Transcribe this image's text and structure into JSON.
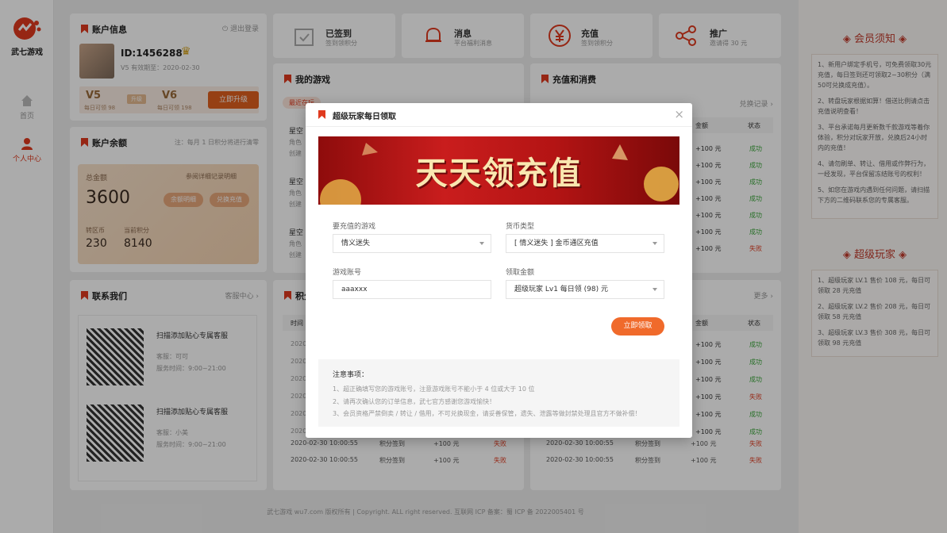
{
  "brand": {
    "name": "武七游戏"
  },
  "nav": {
    "home": "首页",
    "personal": "个人中心"
  },
  "account": {
    "title": "账户信息",
    "logout": "退出登录",
    "id": "ID:1456288",
    "vip_expire": "V5 有效期至：2020-02-30",
    "level_current": "V5",
    "level_current_desc": "每日可领 98",
    "upgrade_tag": "升级",
    "level_next": "V6",
    "level_next_desc": "每日可领 198",
    "upgrade_button": "立即升级"
  },
  "balance": {
    "title": "账户余额",
    "note": "注：每月 1 日积分将进行清零",
    "total_label": "总金额",
    "total": "3600",
    "exchange_record": "兑换记录",
    "details_link": "参阅详细记录明细",
    "balance_detail": "余额明细",
    "exchange_recharge": "兑换充值",
    "coin_label": "转区币",
    "coin_value": "230",
    "points_label": "当前积分",
    "points_value": "8140"
  },
  "quick": [
    {
      "title": "已签到",
      "desc": "签到领积分"
    },
    {
      "title": "消息",
      "desc": "平台福利消息"
    },
    {
      "title": "充值",
      "desc": "签到领积分"
    },
    {
      "title": "推广",
      "desc": "邀请得 30 元"
    }
  ],
  "my_games": {
    "title": "我的游戏",
    "tab": "最近在玩",
    "row_title": "星空",
    "row_desc1": "角色",
    "row_desc2": "创建"
  },
  "recharge": {
    "title": "充值和消费",
    "link": "兑换记录",
    "col_amount": "金额",
    "col_status": "状态"
  },
  "contact": {
    "title": "联系我们",
    "link": "客服中心",
    "items": [
      {
        "title": "扫描添加贴心专属客服",
        "name": "客服：可可",
        "hours": "服务时间：9:00~21:00"
      },
      {
        "title": "扫描添加贴心专属客服",
        "name": "客服：小美",
        "hours": "服务时间：9:00~21:00"
      }
    ]
  },
  "points": {
    "title": "积分",
    "col_time": "时间",
    "more": "更多"
  },
  "table_rows": [
    {
      "time": "2020-02-30 10:00:55",
      "type": "积分签到",
      "amount": "+100 元",
      "status": "失败"
    },
    {
      "time": "2020-02-30 10:00:55",
      "type": "积分签到",
      "amount": "+100 元",
      "status": "失败"
    }
  ],
  "status_list_top": [
    "成功",
    "成功",
    "成功",
    "成功",
    "成功",
    "成功",
    "失败"
  ],
  "status_list_bottom": [
    "成功",
    "成功",
    "成功",
    "失败",
    "成功",
    "成功"
  ],
  "amount_each": "+100 元",
  "year_stub": "2020",
  "right_panel": {
    "member_title": "会员须知",
    "member_rules": [
      "1、新用户绑定手机号，可免费领取30元充值，每日签到还可领取2~30积分（满50可兑换成充值）。",
      "2、转盘玩家根据如算！借送比例请点击充值说明查看！",
      "3、平台承诺每月更新数千款游戏等着你体验，积分对玩家开放，兑换后24小时内的充值！",
      "4、请勿刷单、转让、借用或作弊行为，一经发现，平台保留冻结账号的权利！",
      "5、如您在游戏内遇到任何问题，请扫描下方的二维码联系您的专属客服。"
    ],
    "player_title": "超级玩家",
    "player_rules": [
      "1、超级玩家 LV.1 售价 108 元，每日可领取 28 元充值",
      "2、超级玩家 LV.2 售价 208 元，每日可领取 58 元充值",
      "3、超级玩家 LV.3 售价 308 元，每日可领取 98 元充值"
    ]
  },
  "footer": "武七游戏 wu7.com 版权所有  |  Copyright. ALL right reserved. 互联网 ICP 备案：蜀 ICP 备 2022005401 号",
  "modal": {
    "title": "超级玩家每日领取",
    "close": "×",
    "banner_text": "天天领充值",
    "game_label": "要充值的游戏",
    "game_value": "情义迷失",
    "currency_label": "货币类型",
    "currency_value": "[ 情义迷失 ] 金币通区充值",
    "account_label": "游戏账号",
    "account_value": "aaaxxx",
    "amount_label": "领取金额",
    "amount_value": "超级玩家 Lv1 每日领 (98) 元",
    "claim_button": "立即领取",
    "notice_title": "注意事项：",
    "notices": [
      "1、超正确填写您的游戏账号，注意游戏账号不能小于 4 位或大于 10 位",
      "2、请再次确认您的订单信息，武七官方感谢您游戏愉快！",
      "3、会员资格严禁倒卖 / 转让 / 借用，不可兑换现金，请妥善保管，遗失、泄露等做封禁处理且官方不做补偿！"
    ]
  },
  "colors": {
    "accent": "#f06a2b",
    "brand_red": "#e03a1e",
    "success": "#3aa63a",
    "fail": "#e03a1e"
  }
}
